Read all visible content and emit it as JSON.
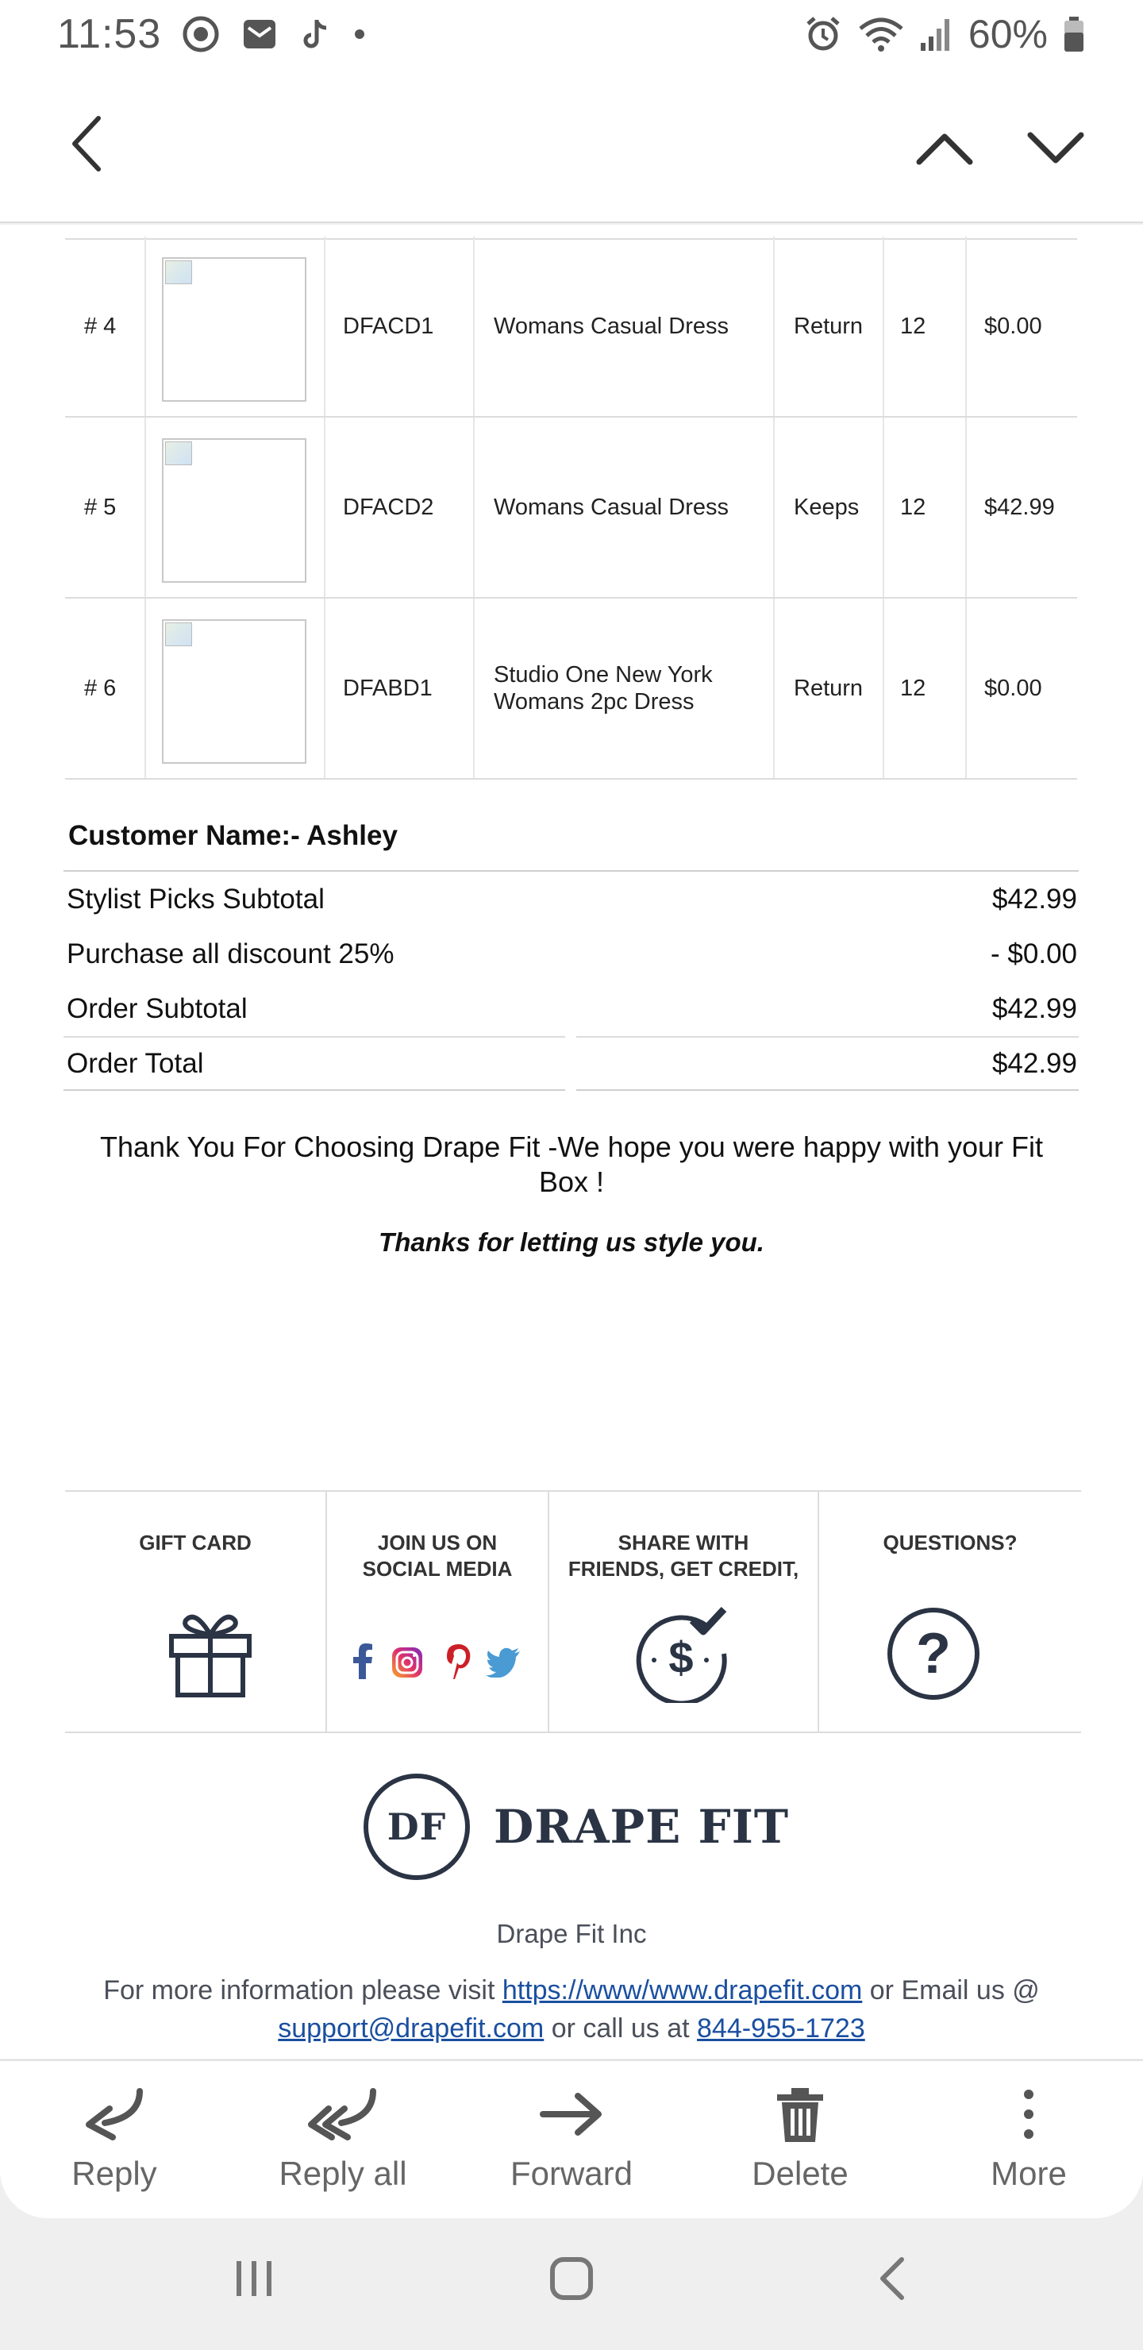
{
  "status_bar": {
    "time": "11:53",
    "battery": "60%"
  },
  "items": [
    {
      "num": "# 4",
      "code": "DFACD1",
      "name_line1": "Womans Casual Dress",
      "name_line2": "",
      "status": "Return",
      "size": "12",
      "price": "$0.00"
    },
    {
      "num": "# 5",
      "code": "DFACD2",
      "name_line1": "Womans Casual Dress",
      "name_line2": "",
      "status": "Keeps",
      "size": "12",
      "price": "$42.99"
    },
    {
      "num": "# 6",
      "code": "DFABD1",
      "name_line1": "Studio One New York",
      "name_line2": "Womans 2pc Dress",
      "status": "Return",
      "size": "12",
      "price": "$0.00"
    }
  ],
  "customer": "Customer Name:- Ashley",
  "summary": {
    "stylist_label": "Stylist Picks Subtotal",
    "stylist_value": "$42.99",
    "discount_label": "Purchase all discount 25%",
    "discount_value": "- $0.00",
    "order_subtotal_label": "Order Subtotal",
    "order_subtotal_value": "$42.99",
    "order_total_label": "Order Total",
    "order_total_value": "$42.99"
  },
  "thanks_text": "Thank You For Choosing Drape Fit -We hope you were happy with your Fit Box !",
  "thanks_italic": "Thanks for letting us style you.",
  "footer": {
    "gift_card": "GIFT CARD",
    "social_line1": "JOIN US ON",
    "social_line2": "SOCIAL MEDIA",
    "share_line1": "SHARE WITH",
    "share_line2": "FRIENDS, GET CREDIT,",
    "questions": "QUESTIONS?"
  },
  "brand": {
    "logo_initials": "DF",
    "name": "DRAPE FIT"
  },
  "company": "Drape Fit Inc",
  "contact": {
    "prefix": "For more information please visit ",
    "url": "https://www/www.drapefit.com",
    "mid": " or Email us @ ",
    "email": "support@drapefit.com",
    "call": " or call us at  ",
    "phone": "844-955-1723"
  },
  "actions": {
    "reply": "Reply",
    "reply_all": "Reply all",
    "forward": "Forward",
    "delete": "Delete",
    "more": "More"
  },
  "colors": {
    "brand_navy": "#2b3444",
    "link_blue": "#1a4fa0",
    "facebook": "#3b5998",
    "pinterest": "#cb2027",
    "twitter": "#4a9ad4"
  }
}
